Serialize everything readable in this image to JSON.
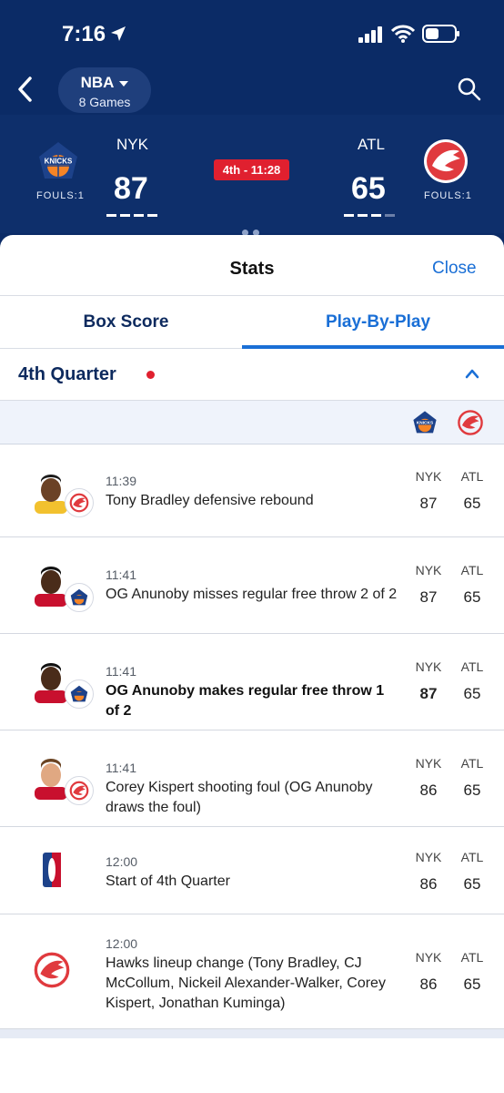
{
  "status_bar": {
    "time": "7:16"
  },
  "nav": {
    "league": "NBA",
    "games": "8 Games"
  },
  "scoreboard": {
    "home": {
      "abbr": "NYK",
      "score": "87",
      "fouls": "FOULS:1",
      "timeouts_remaining": 4,
      "timeouts_total": 4,
      "color": "#f58426"
    },
    "away": {
      "abbr": "ATL",
      "score": "65",
      "fouls": "FOULS:1",
      "timeouts_remaining": 3,
      "timeouts_total": 4,
      "color": "#e03a3e"
    },
    "clock": "4th - 11:28"
  },
  "sheet": {
    "title": "Stats",
    "close_label": "Close"
  },
  "tabs": [
    {
      "label": "Box Score",
      "active": false
    },
    {
      "label": "Play-By-Play",
      "active": true
    }
  ],
  "quarter": {
    "label": "4th Quarter",
    "live": true
  },
  "columns": {
    "home": "NYK",
    "away": "ATL"
  },
  "plays": [
    {
      "time": "11:39",
      "desc": "Tony Bradley defensive rebound",
      "home": "87",
      "away": "65",
      "team": "ATL",
      "bold_home": false,
      "bold_desc": false
    },
    {
      "time": "11:41",
      "desc": "OG Anunoby misses regular free throw 2 of 2",
      "home": "87",
      "away": "65",
      "team": "NYK",
      "bold_home": false,
      "bold_desc": false
    },
    {
      "time": "11:41",
      "desc": "OG Anunoby makes regular free throw 1 of 2",
      "home": "87",
      "away": "65",
      "team": "NYK",
      "bold_home": true,
      "bold_desc": true
    },
    {
      "time": "11:41",
      "desc": "Corey Kispert shooting foul (OG Anunoby draws the foul)",
      "home": "86",
      "away": "65",
      "team": "ATL",
      "bold_home": false,
      "bold_desc": false
    },
    {
      "time": "12:00",
      "desc": "Start of 4th Quarter",
      "home": "86",
      "away": "65",
      "team": "NBA",
      "bold_home": false,
      "bold_desc": false
    },
    {
      "time": "12:00",
      "desc": "Hawks lineup change (Tony Bradley, CJ McCollum, Nickeil Alexander-Walker, Corey Kispert, Jonathan Kuminga)",
      "home": "86",
      "away": "65",
      "team": "ATL",
      "bold_home": false,
      "bold_desc": false
    }
  ],
  "colors": {
    "navy": "#0b2b66",
    "accent": "#1a6fd6",
    "live": "#e0202f"
  }
}
